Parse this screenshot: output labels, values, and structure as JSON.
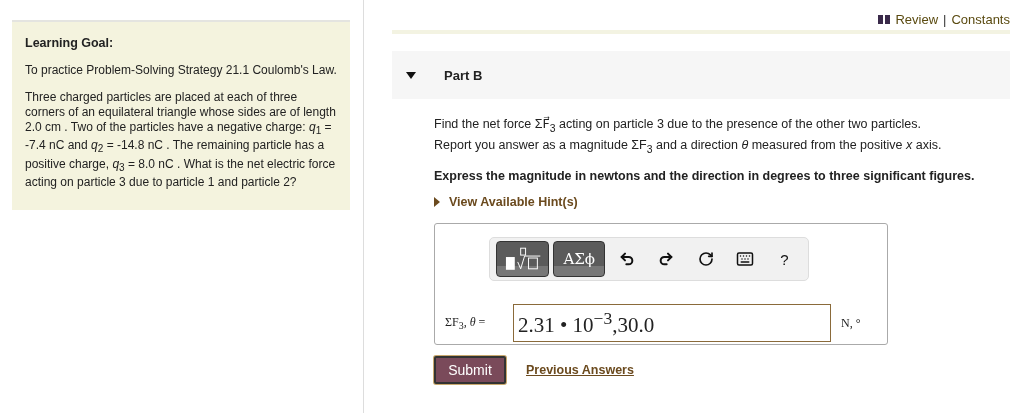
{
  "learning_goal": {
    "title": "Learning Goal:",
    "paragraphs": [
      "To practice Problem-Solving Strategy 21.1 Coulomb's Law.",
      "Three charged particles are placed at each of three corners of an equilateral triangle whose sides are of length 2.0 cm . Two of the particles have a negative charge: *q*$_{1}$ = -7.4 nC and *q*$_{2}$ = -14.8 nC . The remaining particle has a positive charge, *q*$_{3}$ = 8.0 nC . What is the net electric force acting on particle 3 due to particle 1 and particle 2?"
    ]
  },
  "header": {
    "links": [
      "Review",
      "Constants"
    ],
    "separator": "|"
  },
  "part": {
    "title": "Part B",
    "expanded": true
  },
  "prompt": [
    "Find the net force ΣF⃗$_{3}$ acting on particle 3 due to the presence of the other two particles.",
    "Report you answer as a magnitude ΣF$_{3}$ and a direction *θ* measured from the positive *x* axis."
  ],
  "instruction": "Express the magnitude in newtons and the direction in degrees to three significant figures.",
  "hints": {
    "label": "View Available Hint(s)",
    "expanded": false
  },
  "toolbar": [
    {
      "kind": "templates"
    },
    {
      "kind": "symbols",
      "label": "ΑΣϕ"
    },
    {
      "kind": "undo"
    },
    {
      "kind": "redo"
    },
    {
      "kind": "reset"
    },
    {
      "kind": "keyboard"
    },
    {
      "kind": "help",
      "label": "?"
    }
  ],
  "answer": {
    "label": "ΣF$_{3}$, *θ* =",
    "value": "2.31 • 10$^{−3}$,30.0",
    "units": "N, °"
  },
  "submit": "Submit",
  "previous_answers": "Previous Answers"
}
